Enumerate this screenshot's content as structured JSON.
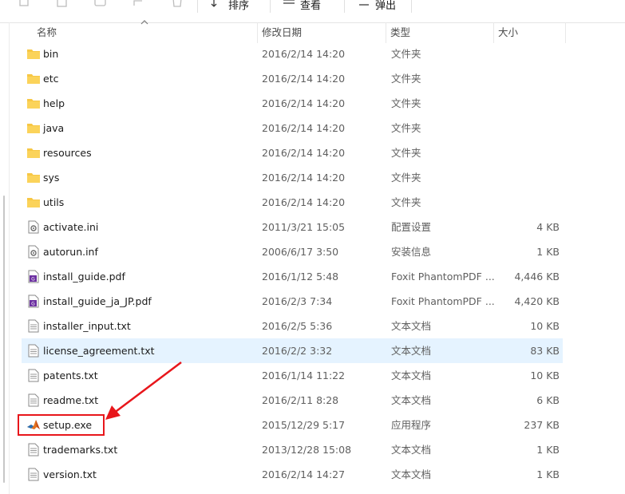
{
  "toolbar": {
    "sort_label": "排序",
    "view_label": "查看",
    "eject_label": "弹出",
    "more_label": "···"
  },
  "columns": {
    "name": "名称",
    "date": "修改日期",
    "type": "类型",
    "size": "大小"
  },
  "files": [
    {
      "name": "bin",
      "date": "2016/2/14 14:20",
      "type": "文件夹",
      "size": "",
      "icon": "folder-icon"
    },
    {
      "name": "etc",
      "date": "2016/2/14 14:20",
      "type": "文件夹",
      "size": "",
      "icon": "folder-icon"
    },
    {
      "name": "help",
      "date": "2016/2/14 14:20",
      "type": "文件夹",
      "size": "",
      "icon": "folder-icon"
    },
    {
      "name": "java",
      "date": "2016/2/14 14:20",
      "type": "文件夹",
      "size": "",
      "icon": "folder-icon"
    },
    {
      "name": "resources",
      "date": "2016/2/14 14:20",
      "type": "文件夹",
      "size": "",
      "icon": "folder-icon"
    },
    {
      "name": "sys",
      "date": "2016/2/14 14:20",
      "type": "文件夹",
      "size": "",
      "icon": "folder-icon"
    },
    {
      "name": "utils",
      "date": "2016/2/14 14:20",
      "type": "文件夹",
      "size": "",
      "icon": "folder-icon"
    },
    {
      "name": "activate.ini",
      "date": "2011/3/21 15:05",
      "type": "配置设置",
      "size": "4 KB",
      "icon": "settings-file-icon"
    },
    {
      "name": "autorun.inf",
      "date": "2006/6/17 3:50",
      "type": "安装信息",
      "size": "1 KB",
      "icon": "settings-file-icon"
    },
    {
      "name": "install_guide.pdf",
      "date": "2016/1/12 5:48",
      "type": "Foxit PhantomPDF ...",
      "size": "4,446 KB",
      "icon": "pdf-file-icon"
    },
    {
      "name": "install_guide_ja_JP.pdf",
      "date": "2016/2/3 7:34",
      "type": "Foxit PhantomPDF ...",
      "size": "4,420 KB",
      "icon": "pdf-file-icon"
    },
    {
      "name": "installer_input.txt",
      "date": "2016/2/5 5:36",
      "type": "文本文档",
      "size": "10 KB",
      "icon": "text-file-icon"
    },
    {
      "name": "license_agreement.txt",
      "date": "2016/2/2 3:32",
      "type": "文本文档",
      "size": "83 KB",
      "icon": "text-file-icon",
      "hover": true
    },
    {
      "name": "patents.txt",
      "date": "2016/1/14 11:22",
      "type": "文本文档",
      "size": "10 KB",
      "icon": "text-file-icon"
    },
    {
      "name": "readme.txt",
      "date": "2016/2/11 8:28",
      "type": "文本文档",
      "size": "6 KB",
      "icon": "text-file-icon"
    },
    {
      "name": "setup.exe",
      "date": "2015/12/29 5:17",
      "type": "应用程序",
      "size": "237 KB",
      "icon": "matlab-app-icon"
    },
    {
      "name": "trademarks.txt",
      "date": "2013/12/28 15:08",
      "type": "文本文档",
      "size": "1 KB",
      "icon": "text-file-icon"
    },
    {
      "name": "version.txt",
      "date": "2016/2/14 14:27",
      "type": "文本文档",
      "size": "1 KB",
      "icon": "text-file-icon"
    }
  ],
  "colors": {
    "folder": "#f7c744",
    "hover_row": "#e5f3ff",
    "annotation": "#e8161b"
  }
}
